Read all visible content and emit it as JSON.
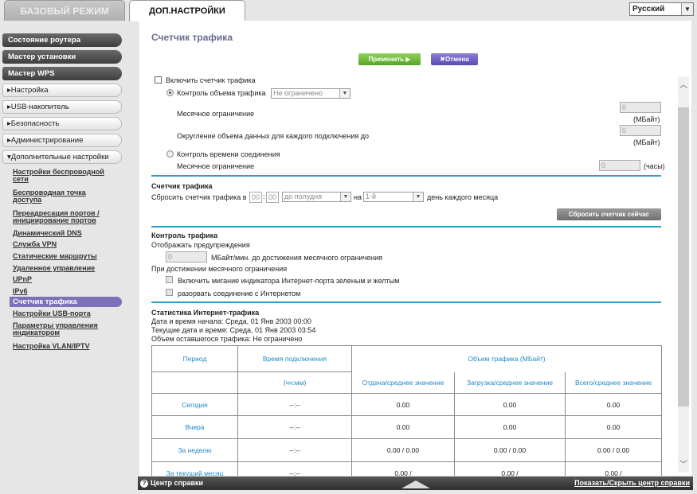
{
  "tabs": {
    "basic": "БАЗОВЫЙ РЕЖИМ",
    "advanced": "ДОП.НАСТРОЙКИ"
  },
  "language": "Русский",
  "sidebar": {
    "router_status": "Состояние роутера",
    "setup_wizard": "Мастер установки",
    "wps_wizard": "Мастер WPS",
    "setup": "▸Настройка",
    "usb": "▸USB-накопитель",
    "security": "▸Безопасность",
    "admin": "▸Администрирование",
    "advanced": "▾Дополнительные настройки",
    "sub": [
      "Настройки беспроводной сети",
      "Беспроводная точка доступа",
      "Переадресация портов / инициирование портов",
      "Динамический DNS",
      "Служба VPN",
      "Статические маршруты",
      "Удаленное управление",
      "UPnP",
      "IPv6",
      "Счетчик трафика",
      "Настройки USB-порта",
      "Параметры управления индикатором",
      "Настройка VLAN/IPTV"
    ]
  },
  "page": {
    "title": "Счетчик трафика",
    "apply": "Применить ▶",
    "cancel": "✖Отмена",
    "enable_meter": "Включить счетчик трафика",
    "volume_control": "Контроль объема трафика",
    "volume_select": "Не ограничено",
    "monthly_limit": "Месячное ограничение",
    "monthly_limit_value": "0",
    "mb_unit": "(МБайт)",
    "rounding": "Округление объема данных для каждого подключения до",
    "rounding_value": "0",
    "time_control": "Контроль времени соединения",
    "monthly_limit2": "Месячное ограничение",
    "time_value": "0",
    "hours_unit": "(часы)",
    "counter_title": "Счетчик трафика",
    "reset_at": "Сбросить счетчик трафика в",
    "hour": "00",
    "minute": "00",
    "ampm": "до полудня",
    "on": "на",
    "day": "1-й",
    "day_of_month": "день каждого месяца",
    "reset_now": "Сбросить счетчик сейчас",
    "control_title": "Контроль трафика",
    "show_warning": "Отображать предупреждения",
    "warning_value": "0",
    "warning_unit": "МБайт/мин. до достижения месячного ограничения",
    "when_reached": "При достижении месячного ограничения",
    "blink_led": "Включить мигание индикатора Интернет-порта зеленым и желтым",
    "disconnect": "разорвать соединение с Интернетом",
    "stats_title": "Статистика Интернет-трафика",
    "start_date": "Дата и время начала: Среда, 01 Янв 2003 00:00",
    "current_date": "Текущие дата и время: Среда, 01 Янв 2003 03:54",
    "remaining": "Объем оставшегося трафика: Не ограничено"
  },
  "table": {
    "h_period": "Период",
    "h_conn_time": "Время подключения",
    "h_volume": "Объем трафика (МБайт)",
    "h_hhmm": "(чч:мм)",
    "h_upload": "Отдача/среднее значение",
    "h_download": "Загрузка/среднее значение",
    "h_total": "Всего/среднее значение",
    "rows": [
      {
        "period": "Сегодня",
        "time": "--:--",
        "up": "0.00",
        "down": "0.00",
        "total": "0.00"
      },
      {
        "period": "Вчера",
        "time": "--:--",
        "up": "0.00",
        "down": "0.00",
        "total": "0.00"
      },
      {
        "period": "За неделю",
        "time": "--:--",
        "up": "0.00 / 0.00",
        "down": "0.00 / 0.00",
        "total": "0.00 / 0.00"
      },
      {
        "period": "За текущий месяц",
        "time": "--:--",
        "up": "0.00 /",
        "down": "0.00 /",
        "total": "0.00 /"
      }
    ]
  },
  "footer": {
    "help": "Центр справки",
    "toggle": "Показать/Скрыть центр справки"
  }
}
